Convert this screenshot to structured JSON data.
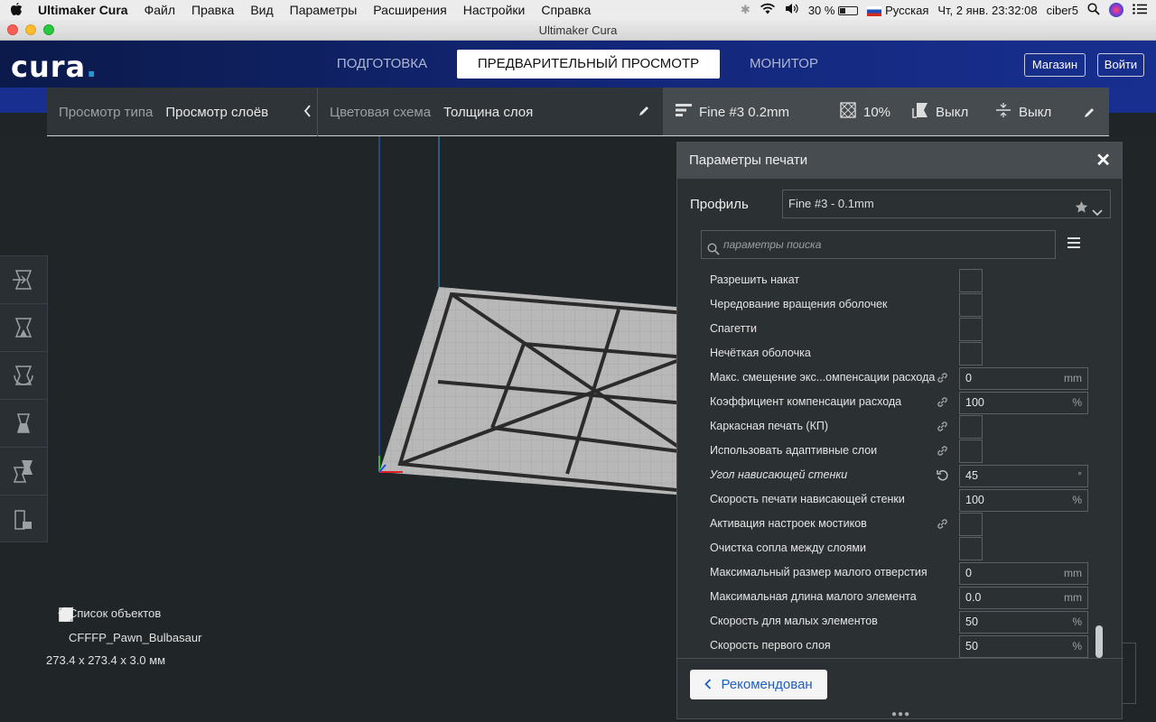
{
  "menubar": {
    "app": "Ultimaker Cura",
    "items": [
      "Файл",
      "Правка",
      "Вид",
      "Параметры",
      "Расширения",
      "Настройки",
      "Справка"
    ],
    "battery": "30 %",
    "input_source": "Русская",
    "datetime": "Чт, 2 янв.  23:32:08",
    "user": "ciber5"
  },
  "window": {
    "title": "Ultimaker Cura"
  },
  "header": {
    "logo": "cura",
    "stages": [
      "ПОДГОТОВКА",
      "ПРЕДВАРИТЕЛЬНЫЙ ПРОСМОТР",
      "МОНИТОР"
    ],
    "active_stage": "ПРЕДВАРИТЕЛЬНЫЙ ПРОСМОТР",
    "marketplace_label": "Магазин",
    "signin_label": "Войти"
  },
  "viewbar": {
    "view_type_label": "Просмотр типа",
    "view_type_value": "Просмотр слоёв",
    "color_scheme_label": "Цветовая схема",
    "color_scheme_value": "Толщина слоя"
  },
  "printbar": {
    "profile": "Fine #3 0.2mm",
    "infill": "10%",
    "support": "Выкл",
    "adhesion": "Выкл"
  },
  "panel": {
    "title": "Параметры печати",
    "profile_label": "Профиль",
    "profile_value": "Fine #3 - 0.1mm",
    "search_placeholder": "параметры поиска",
    "recommended_label": "Рекомендован",
    "settings": [
      {
        "name": "Разрешить накат",
        "type": "check"
      },
      {
        "name": "Чередование вращения оболочек",
        "type": "check"
      },
      {
        "name": "Спагетти",
        "type": "check"
      },
      {
        "name": "Нечёткая оболочка",
        "type": "check"
      },
      {
        "name": "Макс. смещение экс...омпенсации расхода",
        "type": "field",
        "value": "0",
        "unit": "mm",
        "linked": true
      },
      {
        "name": "Коэффициент компенсации расхода",
        "type": "field",
        "value": "100",
        "unit": "%",
        "linked": true
      },
      {
        "name": "Каркасная печать (КП)",
        "type": "check",
        "linked": true
      },
      {
        "name": "Использовать адаптивные слои",
        "type": "check",
        "linked": true
      },
      {
        "name": "Угол нависающей стенки",
        "type": "field",
        "value": "45",
        "unit": "°",
        "reset": true,
        "italic": true
      },
      {
        "name": "Скорость печати нависающей стенки",
        "type": "field",
        "value": "100",
        "unit": "%"
      },
      {
        "name": "Активация настроек мостиков",
        "type": "check",
        "linked": true
      },
      {
        "name": "Очистка сопла между слоями",
        "type": "check"
      },
      {
        "name": "Максимальный размер малого отверстия",
        "type": "field",
        "value": "0",
        "unit": "mm"
      },
      {
        "name": "Максимальная длина малого элемента",
        "type": "field",
        "value": "0.0",
        "unit": "mm"
      },
      {
        "name": "Скорость для малых элементов",
        "type": "field",
        "value": "50",
        "unit": "%"
      },
      {
        "name": "Скорость первого слоя",
        "type": "field",
        "value": "50",
        "unit": "%"
      }
    ]
  },
  "objects": {
    "header": "Список объектов",
    "name": "CFFFP_Pawn_Bulbasaur",
    "dimensions": "273.4 x 273.4 x 3.0 мм"
  },
  "colors": {
    "header_start": "#0b1a4a",
    "header_end": "#182f8f",
    "accent": "#1e9bd7",
    "link": "#1d5fc2"
  }
}
